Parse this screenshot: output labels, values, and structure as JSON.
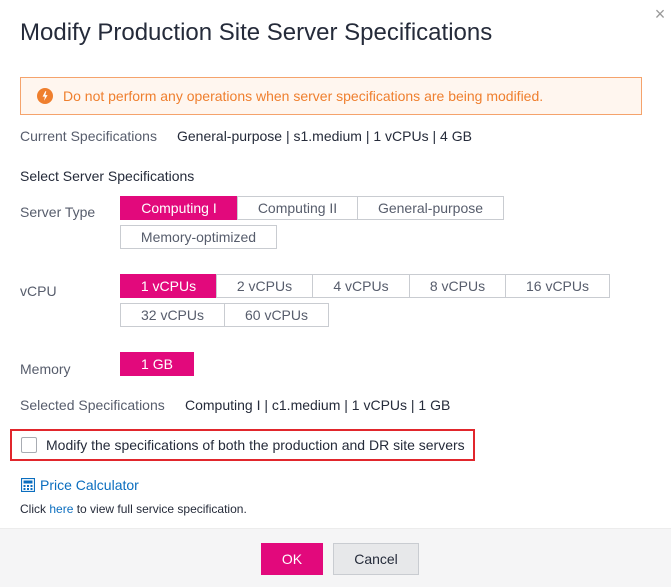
{
  "dialog": {
    "title": "Modify Production Site Server Specifications",
    "close_icon": "close-icon"
  },
  "warning": {
    "icon": "warning-icon",
    "text": "Do not perform any operations when server specifications are being modified.",
    "color": "#ef7f2e"
  },
  "current": {
    "label": "Current Specifications",
    "value": "General-purpose | s1.medium | 1 vCPUs | 4 GB"
  },
  "select_section": {
    "label": "Select Server Specifications"
  },
  "server_type": {
    "label": "Server Type",
    "options": [
      "Computing I",
      "Computing II",
      "General-purpose",
      "Memory-optimized"
    ],
    "selected": "Computing I"
  },
  "vcpu": {
    "label": "vCPU",
    "options": [
      "1 vCPUs",
      "2 vCPUs",
      "4 vCPUs",
      "8 vCPUs",
      "16 vCPUs",
      "32 vCPUs",
      "60 vCPUs"
    ],
    "selected": "1 vCPUs"
  },
  "memory": {
    "label": "Memory",
    "options": [
      "1 GB"
    ],
    "selected": "1 GB"
  },
  "selected_spec": {
    "label": "Selected Specifications",
    "value": "Computing I | c1.medium | 1 vCPUs | 1 GB"
  },
  "dr_option": {
    "label": "Modify the specifications of both the production and DR site servers",
    "checked": false
  },
  "price_calculator": {
    "icon": "calculator-icon",
    "label": "Price Calculator"
  },
  "note": {
    "prefix": "Click ",
    "link": "here",
    "suffix": " to view full service specification."
  },
  "footer": {
    "ok_label": "OK",
    "cancel_label": "Cancel"
  },
  "colors": {
    "accent": "#e2097c",
    "link": "#0b6ebf",
    "highlight_border": "#e1262c"
  }
}
